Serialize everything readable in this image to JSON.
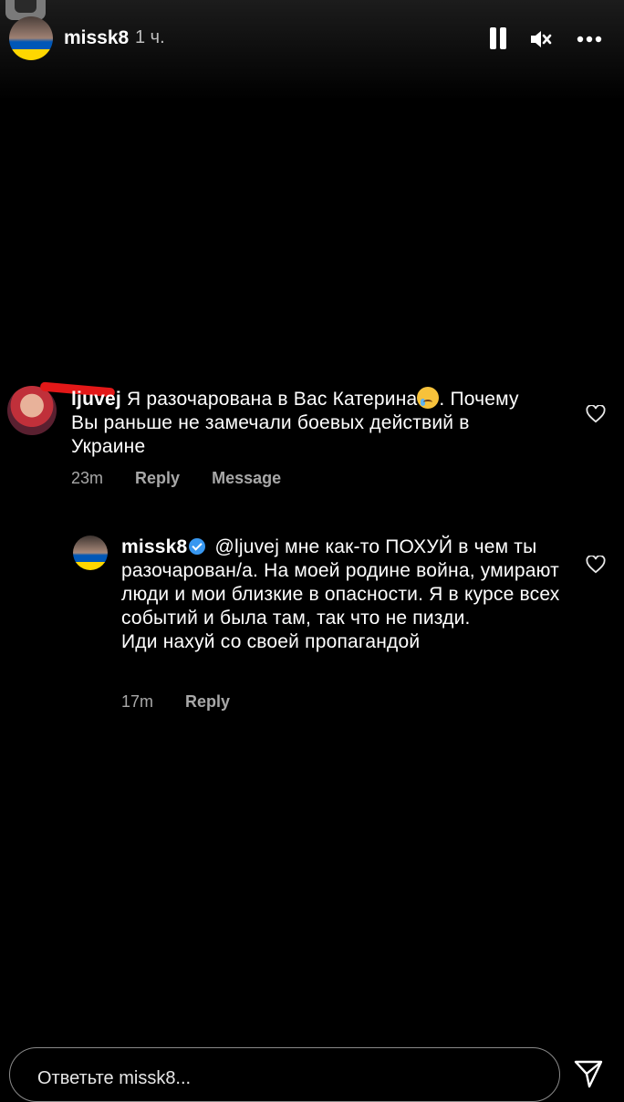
{
  "story": {
    "owner": "missk8",
    "time_ago": "1 ч.",
    "controls": {
      "pause_icon": "pause-icon",
      "mute_icon": "volume-muted-icon",
      "more_icon": "more-horizontal-icon"
    }
  },
  "comments": [
    {
      "username": "ljuvej",
      "text_before_emoji": "Я разочарована в Вас Катерина",
      "emoji": "crying-face",
      "text_after_emoji": ". Почему Вы раньше не замечали боевых действий в Украине",
      "time": "23m",
      "reply_label": "Reply",
      "message_label": "Message",
      "like_icon": "heart-outline-icon"
    },
    {
      "username": "missk8",
      "verified": true,
      "body": "@ljuvej мне как-то ПОХУЙ в чем ты разочарован/а. На моей родине война, умирают люди и мои близкие в опасности. Я в курсе всех событий и была там, так что не пизди.",
      "body_line2": "Иди нахуй со своей пропагандой",
      "time": "17m",
      "reply_label": "Reply",
      "like_icon": "heart-outline-icon"
    }
  ],
  "reply_bar": {
    "placeholder": "Ответьте missk8...",
    "send_icon": "send-icon"
  },
  "colors": {
    "background": "#000000",
    "muted_text": "#a8a8a8",
    "verified": "#3897f0",
    "redaction": "#e31818"
  }
}
